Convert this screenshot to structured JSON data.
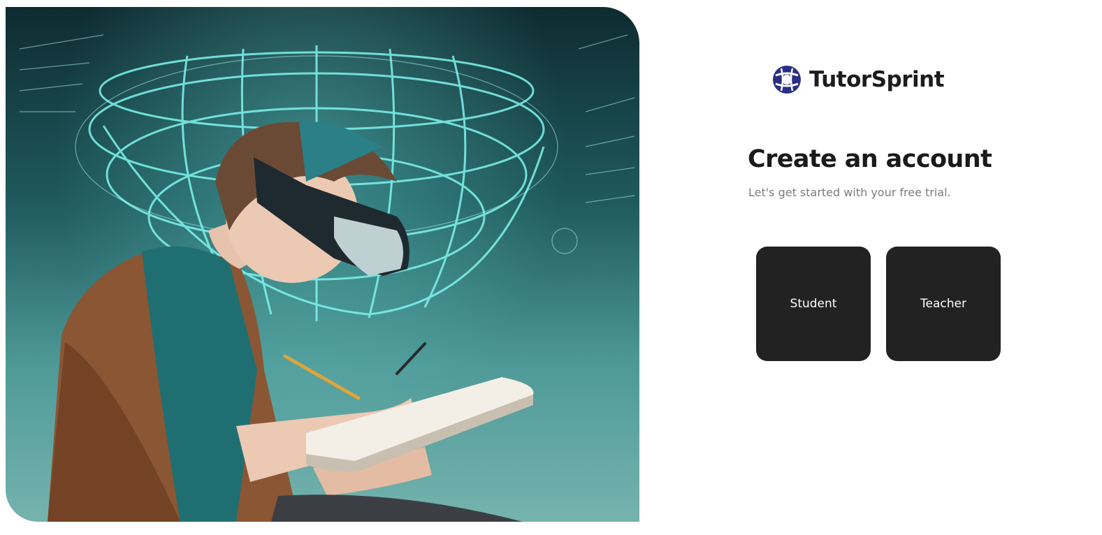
{
  "brand": {
    "name": "TutorSprint",
    "logo_icon": "tutorsprint-logo-icon",
    "logo_color": "#2b2e86"
  },
  "hero": {
    "image": "student-with-vr-headset-writing-in-notebook",
    "accent_color": "#6ff0e8"
  },
  "signup": {
    "title": "Create an account",
    "subtitle": "Let's get started with your free trial."
  },
  "roles": [
    {
      "label": "Student"
    },
    {
      "label": "Teacher"
    }
  ],
  "colors": {
    "card_bg": "#222222",
    "card_text": "#ffffff",
    "title": "#1a1a1a",
    "subtitle": "#7b7b7b"
  }
}
